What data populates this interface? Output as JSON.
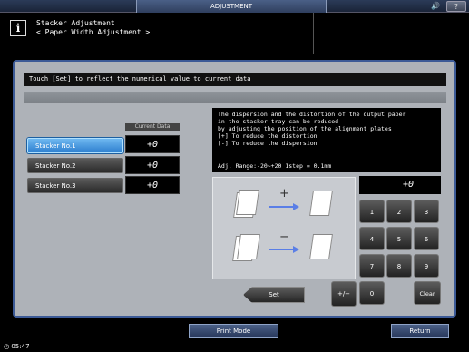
{
  "topbar": {
    "tab_label": "ADJUSTMENT",
    "speaker_icon": "speaker-icon",
    "help_label": "?"
  },
  "header": {
    "info_glyph": "i",
    "title": "Stacker Adjustment",
    "subtitle": "< Paper Width Adjustment >"
  },
  "message": "Touch [Set] to reflect the numerical value to current data",
  "current_data_header": "Current Data",
  "stackers": [
    {
      "label": "Stacker No.1",
      "value": "+0",
      "selected": true
    },
    {
      "label": "Stacker No.2",
      "value": "+0",
      "selected": false
    },
    {
      "label": "Stacker No.3",
      "value": "+0",
      "selected": false
    }
  ],
  "description": {
    "lines": [
      "The dispersion and the distortion of the output paper",
      "in the stacker tray can be reduced",
      "by adjusting the position of the alignment plates",
      "[+] To reduce the distortion",
      "[-] To reduce the dispersion"
    ],
    "range": "Adj. Range:-20~+20 1step = 0.1mm"
  },
  "illustration": {
    "plus_symbol": "+",
    "minus_symbol": "−"
  },
  "input_value": "+0",
  "keypad": {
    "k1": "1",
    "k2": "2",
    "k3": "3",
    "k4": "4",
    "k5": "5",
    "k6": "6",
    "k7": "7",
    "k8": "8",
    "k9": "9",
    "k0": "0",
    "clear": "Clear",
    "plusminus": "+/−"
  },
  "set_label": "Set",
  "footer": {
    "print_mode": "Print Mode",
    "return": "Return"
  },
  "status": {
    "clock_icon": "clock-icon",
    "time": "05:47"
  },
  "colors": {
    "accent_blue": "#2e7fcf",
    "panel_gray": "#aeb2b8",
    "arrow_blue": "#5a7ee6"
  }
}
